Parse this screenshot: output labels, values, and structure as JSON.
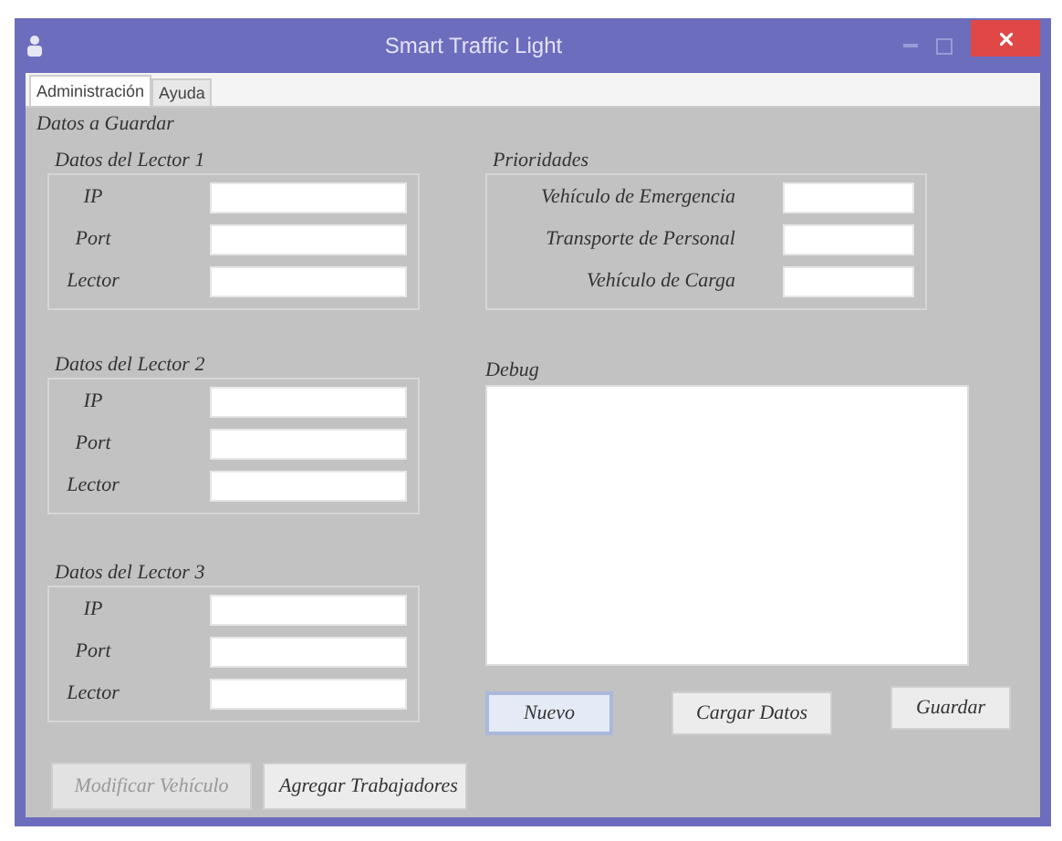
{
  "window": {
    "title": "Smart Traffic Light"
  },
  "tabs": [
    {
      "label": "Administración",
      "selected": true
    },
    {
      "label": "Ayuda",
      "selected": false
    }
  ],
  "section_label": "Datos a Guardar",
  "readers": [
    {
      "title": "Datos del Lector 1",
      "fields": [
        "IP",
        "Port",
        "Lector"
      ]
    },
    {
      "title": "Datos del Lector 2",
      "fields": [
        "IP",
        "Port",
        "Lector"
      ]
    },
    {
      "title": "Datos del Lector 3",
      "fields": [
        "IP",
        "Port",
        "Lector"
      ]
    }
  ],
  "priorities": {
    "title": "Prioridades",
    "fields": [
      "Vehículo de Emergencia",
      "Transporte de Personal",
      "Vehículo de Carga"
    ]
  },
  "debug": {
    "label": "Debug"
  },
  "action_buttons": [
    {
      "label": "Nuevo",
      "focused": true
    },
    {
      "label": "Cargar Datos",
      "focused": false
    },
    {
      "label": "Guardar",
      "focused": false
    }
  ],
  "bottom_buttons": [
    {
      "label": "Modificar Vehículo",
      "disabled": true
    },
    {
      "label": "Agregar Trabajadores",
      "disabled": false
    }
  ]
}
